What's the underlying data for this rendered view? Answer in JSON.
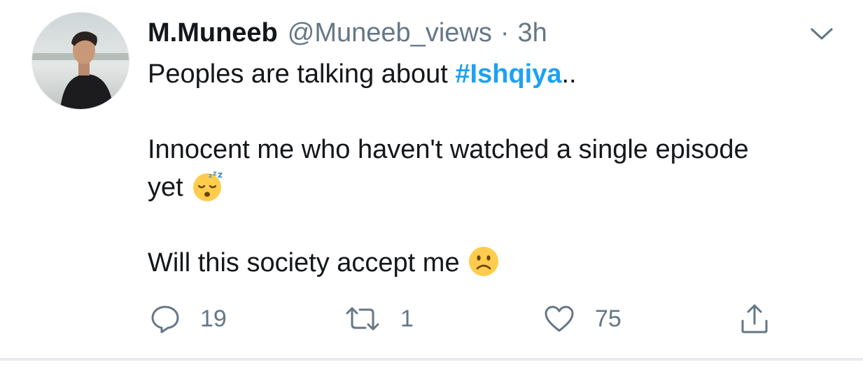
{
  "tweet": {
    "author": {
      "display_name": "M.Muneeb",
      "handle": "@Muneeb_views",
      "separator": "·",
      "time": "3h"
    },
    "text": {
      "line1_before": "Peoples are talking about ",
      "hashtag": "#Ishqiya",
      "line1_after": "..",
      "line2": "Innocent me who haven't watched a single episode",
      "line3": "yet",
      "line4": "Will this society accept me"
    },
    "emojis": [
      "sleeping-face-emoji",
      "slightly-frowning-face-emoji"
    ],
    "actions": {
      "reply_count": "19",
      "retweet_count": "1",
      "like_count": "75"
    },
    "icons": [
      "chevron-down-icon",
      "reply-icon",
      "retweet-icon",
      "like-icon",
      "share-icon"
    ],
    "colors": {
      "text": "#14171a",
      "secondary": "#657786",
      "link": "#1da1f2",
      "emoji": "#ffcc4d"
    }
  }
}
